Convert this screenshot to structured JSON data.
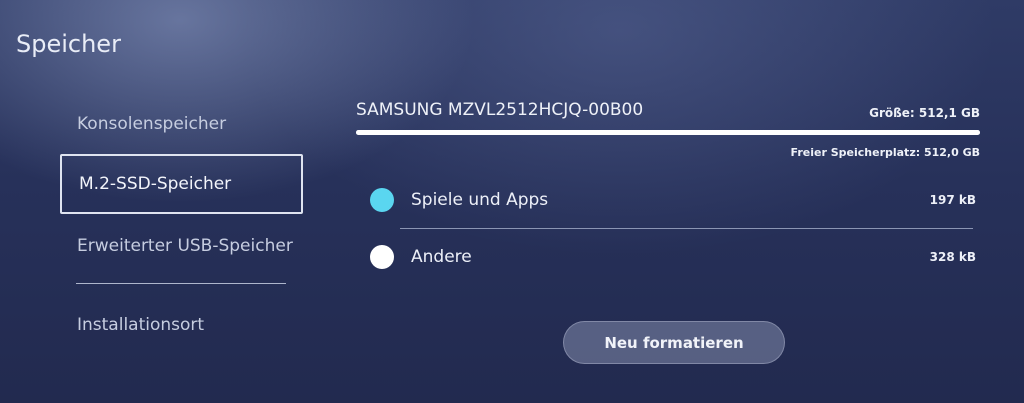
{
  "page": {
    "title": "Speicher"
  },
  "sidebar": {
    "items": [
      {
        "label": "Konsolenspeicher"
      },
      {
        "label": "M.2-SSD-Speicher"
      },
      {
        "label": "Erweiterter USB-Speicher"
      },
      {
        "label": "Installationsort"
      }
    ],
    "selected_index": 1
  },
  "drive": {
    "name": "SAMSUNG MZVL2512HCJQ-00B00",
    "size_label": "Größe: 512,1 GB",
    "free_label": "Freier Speicherplatz: 512,0 GB",
    "free_fraction": 0.9998
  },
  "usage": [
    {
      "label": "Spiele und Apps",
      "value": "197 kB",
      "color": "#5ad6f0"
    },
    {
      "label": "Andere",
      "value": "328 kB",
      "color": "#ffffff"
    }
  ],
  "actions": {
    "format_label": "Neu formatieren"
  }
}
